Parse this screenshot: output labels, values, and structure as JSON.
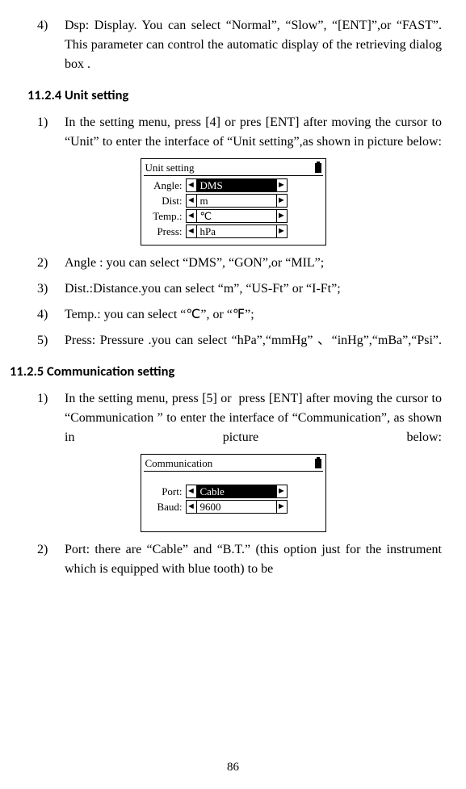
{
  "items4": {
    "num": "4)",
    "text": "Dsp: Display. You can select “Normal”, “Slow”, “[ENT]”,or “FAST”. This parameter can control the automatic display of the retrieving dialog box ."
  },
  "heading1": "11.2.4 Unit setting",
  "unit": {
    "p1": {
      "num": "1)",
      "text": "In the setting menu, press [4] or pres [ENT] after moving the cursor to “Unit” to enter the interface of “Unit setting”,as shown in picture below:"
    },
    "screen": {
      "title": "Unit setting",
      "rows": [
        {
          "label": "Angle:",
          "value": "DMS",
          "selected": true
        },
        {
          "label": "Dist:",
          "value": "m",
          "selected": false
        },
        {
          "label": "Temp.:",
          "value": "℃",
          "selected": false
        },
        {
          "label": "Press:",
          "value": "hPa",
          "selected": false
        }
      ]
    },
    "p2": {
      "num": "2)",
      "text": "Angle : you can select “DMS”, “GON”,or “MIL”;"
    },
    "p3": {
      "num": "3)",
      "text": "Dist.:Distance.you can select “m”, “US-Ft” or “I-Ft”;"
    },
    "p4": {
      "num": "4)",
      "text": "Temp.: you can select “℃”, or “℉”;"
    },
    "p5": {
      "num": "5)",
      "text": "Press: Pressure .you can select “hPa”,“mmHg” 、“inHg”,“mBa”,“Psi”."
    }
  },
  "heading2": "11.2.5 Communication setting",
  "comm": {
    "p1": {
      "num": "1)",
      "text": "In the setting menu, press [5] or  press [ENT] after moving the cursor to “Communication ” to enter the interface of “Communication”, as shown in picture below:"
    },
    "screen": {
      "title": "Communication",
      "rows": [
        {
          "label": "Port:",
          "value": "Cable",
          "selected": true
        },
        {
          "label": "Baud:",
          "value": "9600",
          "selected": false
        }
      ]
    },
    "p2": {
      "num": "2)",
      "text": "Port: there are “Cable” and “B.T.” (this option just for the instrument which is equipped with blue tooth) to be"
    }
  },
  "arrows": {
    "left": "◄",
    "right": "►"
  },
  "pageNum": "86"
}
